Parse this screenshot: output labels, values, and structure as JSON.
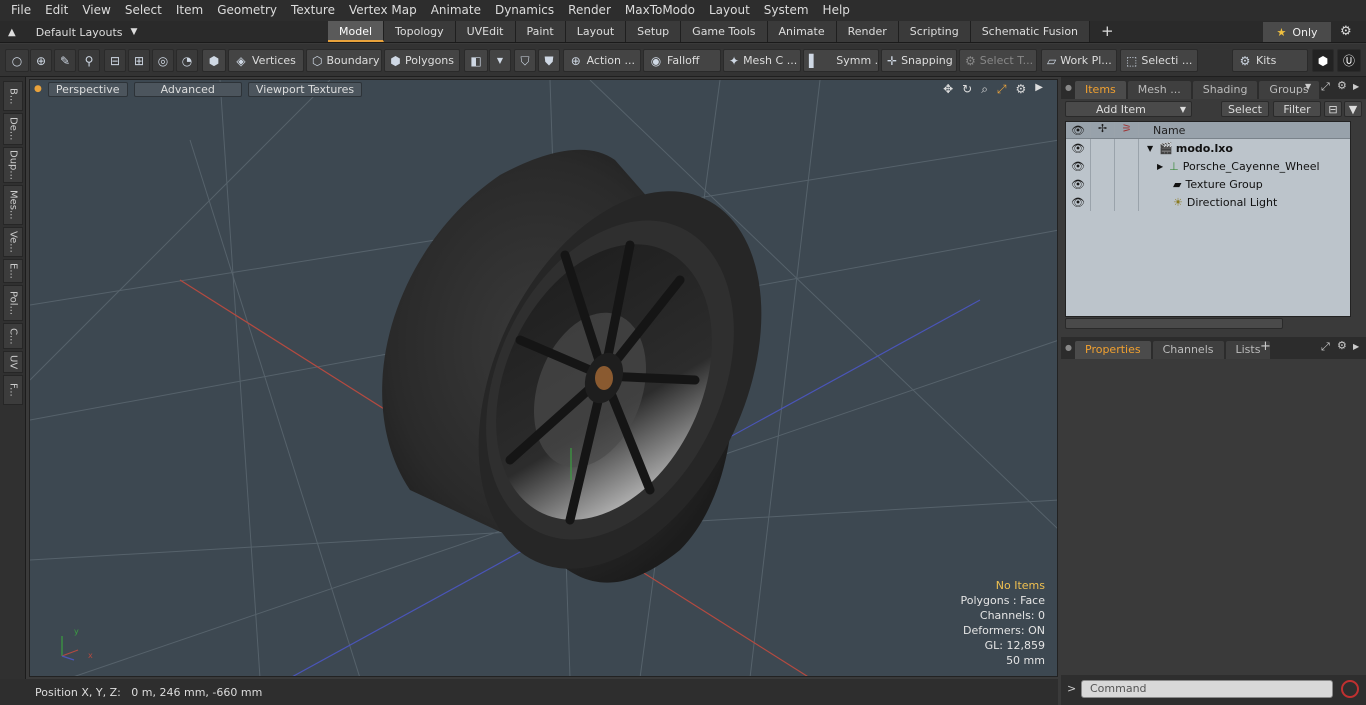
{
  "menu": [
    "File",
    "Edit",
    "View",
    "Select",
    "Item",
    "Geometry",
    "Texture",
    "Vertex Map",
    "Animate",
    "Dynamics",
    "Render",
    "MaxToModo",
    "Layout",
    "System",
    "Help"
  ],
  "layouts_label": "Default Layouts",
  "tabs": [
    {
      "label": "Model",
      "active": true
    },
    {
      "label": "Topology"
    },
    {
      "label": "UVEdit"
    },
    {
      "label": "Paint"
    },
    {
      "label": "Layout"
    },
    {
      "label": "Setup"
    },
    {
      "label": "Game Tools"
    },
    {
      "label": "Animate"
    },
    {
      "label": "Render"
    },
    {
      "label": "Scripting"
    },
    {
      "label": "Schematic Fusion"
    }
  ],
  "only_label": "Only",
  "toolbar": {
    "vertices": "Vertices",
    "boundary": "Boundary",
    "polygons": "Polygons",
    "action": "Action ...",
    "falloff": "Falloff",
    "mesh": "Mesh C ...",
    "symm": "Symm ...",
    "snapping": "Snapping",
    "select_t": "Select T...",
    "workpl": "Work Pl...",
    "selecti": "Selecti ...",
    "kits": "Kits"
  },
  "left_tabs": [
    "B...",
    "De...",
    "Dup...",
    "Mes...",
    "Ve...",
    "E...",
    "Pol...",
    "C...",
    "UV",
    "F..."
  ],
  "viewport": {
    "perspective": "Perspective",
    "advanced": "Advanced",
    "textures": "Viewport Textures"
  },
  "stats": {
    "no_items": "No Items",
    "polygons": "Polygons : Face",
    "channels": "Channels: 0",
    "deformers": "Deformers: ON",
    "gl": "GL: 12,859",
    "size": "50 mm"
  },
  "status": "Position X, Y, Z:   0 m, 246 mm, -660 mm",
  "right_tabs_top": [
    "Items",
    "Mesh ...",
    "Shading",
    "Groups"
  ],
  "items_toolbar": {
    "add_item": "Add Item",
    "select": "Select",
    "filter": "Filter"
  },
  "tree": {
    "name_header": "Name",
    "rows": [
      {
        "label": "modo.lxo",
        "bold": true
      },
      {
        "label": "Porsche_Cayenne_Wheel"
      },
      {
        "label": "Texture Group"
      },
      {
        "label": "Directional Light"
      }
    ]
  },
  "right_tabs_bottom": [
    "Properties",
    "Channels",
    "Lists"
  ],
  "command_placeholder": "Command",
  "colors": {
    "accent": "#e8a23c",
    "viewport_bg": "#3d4851",
    "tree_bg": "#bcc4cb"
  }
}
